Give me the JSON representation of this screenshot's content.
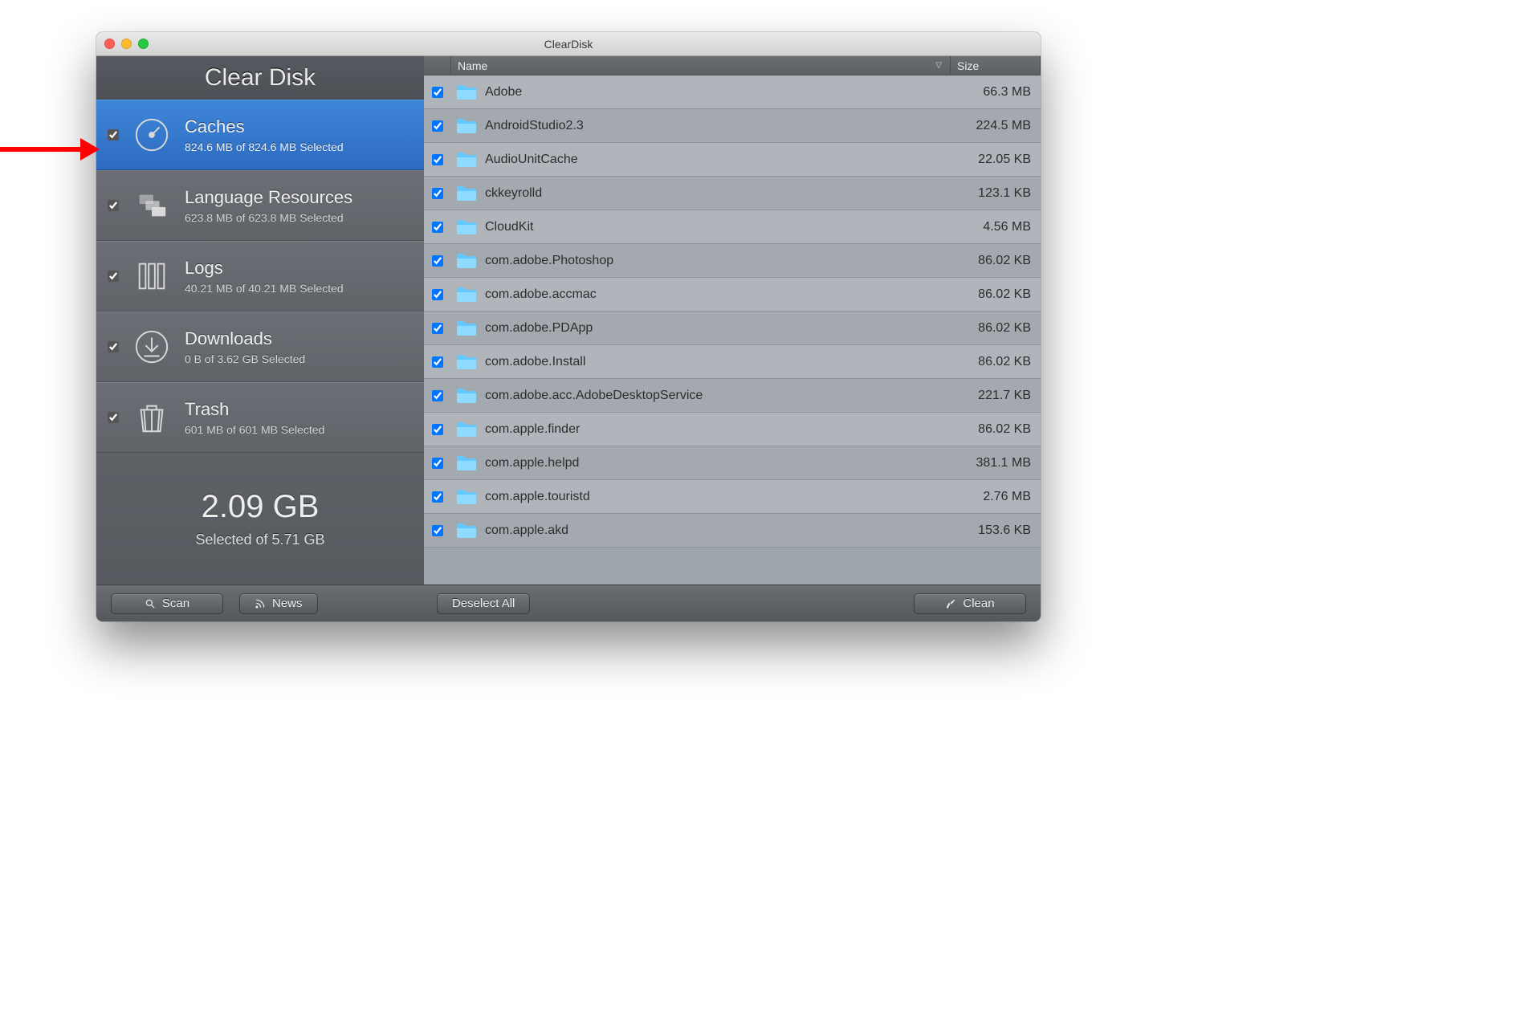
{
  "window_title": "ClearDisk",
  "brand": "Clear Disk",
  "categories": [
    {
      "title": "Caches",
      "subtitle": "824.6 MB of 824.6 MB Selected",
      "selected": true,
      "checked": true,
      "icon": "dial"
    },
    {
      "title": "Language Resources",
      "subtitle": "623.8 MB of 623.8 MB Selected",
      "selected": false,
      "checked": true,
      "icon": "flags"
    },
    {
      "title": "Logs",
      "subtitle": "40.21 MB of 40.21 MB Selected",
      "selected": false,
      "checked": true,
      "icon": "binders"
    },
    {
      "title": "Downloads",
      "subtitle": "0 B of 3.62 GB Selected",
      "selected": false,
      "checked": true,
      "icon": "download"
    },
    {
      "title": "Trash",
      "subtitle": "601 MB of 601 MB Selected",
      "selected": false,
      "checked": true,
      "icon": "trash"
    }
  ],
  "summary": {
    "amount": "2.09 GB",
    "label": "Selected of 5.71 GB"
  },
  "columns": {
    "name": "Name",
    "size": "Size"
  },
  "rows": [
    {
      "name": "Adobe",
      "size": "66.3 MB",
      "checked": true
    },
    {
      "name": "AndroidStudio2.3",
      "size": "224.5 MB",
      "checked": true
    },
    {
      "name": "AudioUnitCache",
      "size": "22.05 KB",
      "checked": true
    },
    {
      "name": "ckkeyrolld",
      "size": "123.1 KB",
      "checked": true
    },
    {
      "name": "CloudKit",
      "size": "4.56 MB",
      "checked": true
    },
    {
      "name": "com.adobe.Photoshop",
      "size": "86.02 KB",
      "checked": true
    },
    {
      "name": "com.adobe.accmac",
      "size": "86.02 KB",
      "checked": true
    },
    {
      "name": "com.adobe.PDApp",
      "size": "86.02 KB",
      "checked": true
    },
    {
      "name": "com.adobe.Install",
      "size": "86.02 KB",
      "checked": true
    },
    {
      "name": "com.adobe.acc.AdobeDesktopService",
      "size": "221.7 KB",
      "checked": true
    },
    {
      "name": "com.apple.finder",
      "size": "86.02 KB",
      "checked": true
    },
    {
      "name": "com.apple.helpd",
      "size": "381.1 MB",
      "checked": true
    },
    {
      "name": "com.apple.touristd",
      "size": "2.76 MB",
      "checked": true
    },
    {
      "name": "com.apple.akd",
      "size": "153.6 KB",
      "checked": true
    }
  ],
  "buttons": {
    "scan": "Scan",
    "news": "News",
    "deselect_all": "Deselect All",
    "clean": "Clean"
  }
}
